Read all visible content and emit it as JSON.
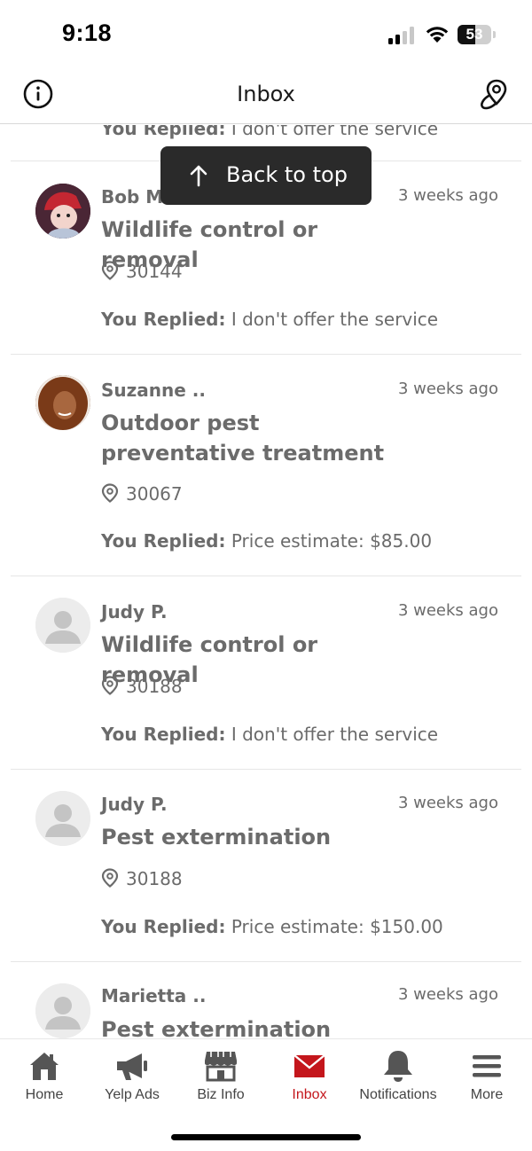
{
  "status_bar": {
    "time": "9:18",
    "battery": "53",
    "battery_level": 0.53
  },
  "header": {
    "title": "Inbox",
    "left_icon": "info-circle-icon",
    "right_icon": "map-pin-icon"
  },
  "partial_item": {
    "reply_prefix": "You Replied:",
    "reply_text": "I don't offer the service"
  },
  "back_to_top": {
    "label": "Back to top",
    "icon": "arrow-up-icon"
  },
  "leads": [
    {
      "name": "Bob M",
      "time": "3 weeks ago",
      "service": "Wildlife control or removal",
      "zip": "30144",
      "reply_prefix": "You Replied:",
      "reply_text": "I don't offer the service",
      "avatar": "photo"
    },
    {
      "name": "Suzanne ..",
      "time": "3 weeks ago",
      "service": "Outdoor pest preventative treatment",
      "zip": "30067",
      "reply_prefix": "You Replied:",
      "reply_text": "Price estimate: $85.00",
      "avatar": "photo"
    },
    {
      "name": "Judy P.",
      "time": "3 weeks ago",
      "service": "Wildlife control or removal",
      "zip": "30188",
      "reply_prefix": "You Replied:",
      "reply_text": "I don't offer the service",
      "avatar": "placeholder"
    },
    {
      "name": "Judy P.",
      "time": "3 weeks ago",
      "service": "Pest extermination",
      "zip": "30188",
      "reply_prefix": "You Replied:",
      "reply_text": "Price estimate: $150.00",
      "avatar": "placeholder"
    },
    {
      "name": "Marietta ..",
      "time": "3 weeks ago",
      "service": "Pest extermination",
      "avatar": "placeholder"
    }
  ],
  "tab_bar": {
    "active": "Inbox",
    "accent_color": "#c4161c",
    "tabs": [
      {
        "label": "Home",
        "icon": "home-icon"
      },
      {
        "label": "Yelp Ads",
        "icon": "megaphone-icon"
      },
      {
        "label": "Biz Info",
        "icon": "storefront-icon"
      },
      {
        "label": "Inbox",
        "icon": "envelope-icon"
      },
      {
        "label": "Notifications",
        "icon": "bell-icon"
      },
      {
        "label": "More",
        "icon": "menu-icon"
      }
    ]
  }
}
